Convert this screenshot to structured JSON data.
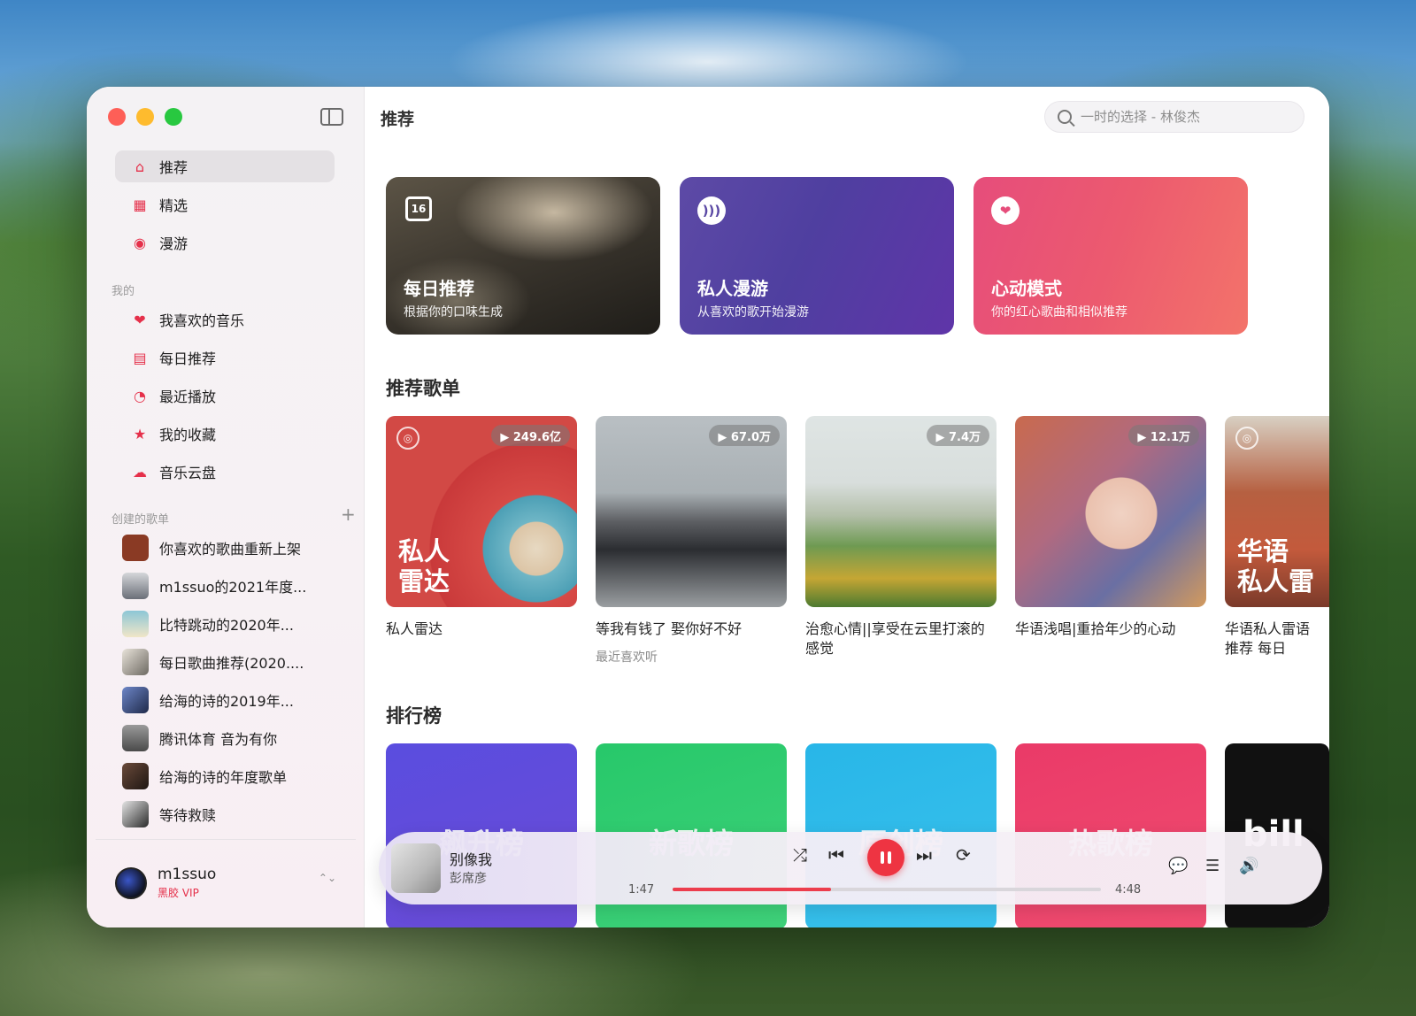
{
  "window_controls": [
    "close",
    "minimize",
    "zoom"
  ],
  "sidebar": {
    "nav": [
      {
        "label": "推荐",
        "icon": "home-icon",
        "glyph": "⌂",
        "active": true
      },
      {
        "label": "精选",
        "icon": "grid-icon",
        "glyph": "▦",
        "active": false
      },
      {
        "label": "漫游",
        "icon": "radio-icon",
        "glyph": "◉",
        "active": false
      }
    ],
    "my_label": "我的",
    "my_items": [
      {
        "label": "我喜欢的音乐",
        "icon": "heart-icon",
        "glyph": "❤"
      },
      {
        "label": "每日推荐",
        "icon": "calendar-icon",
        "glyph": "▤"
      },
      {
        "label": "最近播放",
        "icon": "clock-icon",
        "glyph": "◔"
      },
      {
        "label": "我的收藏",
        "icon": "star-icon",
        "glyph": "★"
      },
      {
        "label": "音乐云盘",
        "icon": "cloud-icon",
        "glyph": "☁"
      }
    ],
    "created_label": "创建的歌单",
    "add_glyph": "+",
    "playlists": [
      {
        "label": "你喜欢的歌曲重新上架",
        "color": "#8a3a24"
      },
      {
        "label": "m1ssuo的2021年度...",
        "color": "#6b6f78"
      },
      {
        "label": "比特跳动的2020年...",
        "color": "#8cc6d6"
      },
      {
        "label": "每日歌曲推荐(2020....",
        "color": "#b8b0a4"
      },
      {
        "label": "给海的诗的2019年...",
        "color": "#4a64a6"
      },
      {
        "label": "腾讯体育 音为有你",
        "color": "#7a7a7a"
      },
      {
        "label": "给海的诗的年度歌单",
        "color": "#3b2a22"
      },
      {
        "label": "等待救赎",
        "color": "#2a2a2a"
      }
    ],
    "user": {
      "name": "m1ssuo",
      "badge": "黑胶 VIP",
      "toggle_glyph": "⌃⌄"
    }
  },
  "header": {
    "title": "推荐",
    "search_placeholder": "一时的选择 - 林俊杰"
  },
  "feature_cards": [
    {
      "title": "每日推荐",
      "subtitle": "根据你的口味生成",
      "icon": "calendar-icon",
      "glyph": "16"
    },
    {
      "title": "私人漫游",
      "subtitle": "从喜欢的歌开始漫游",
      "icon": "radio-icon",
      "glyph": ")))"
    },
    {
      "title": "心动模式",
      "subtitle": "你的红心歌曲和相似推荐",
      "icon": "heart-icon",
      "glyph": "❤"
    }
  ],
  "sections": {
    "playlists_title": "推荐歌单",
    "charts_title": "排行榜"
  },
  "recommended_playlists": [
    {
      "name": "私人雷达",
      "plays": "▶ 249.6亿",
      "cover_text": "私人\n雷达",
      "subtitle": ""
    },
    {
      "name": "等我有钱了 娶你好不好",
      "plays": "▶ 67.0万",
      "cover_text": "",
      "subtitle": "最近喜欢听"
    },
    {
      "name": "治愈心情||享受在云里打滚的感觉",
      "plays": "▶ 7.4万",
      "cover_text": "",
      "subtitle": ""
    },
    {
      "name": "华语浅唱|重拾年少的心动",
      "plays": "▶ 12.1万",
      "cover_text": "",
      "subtitle": ""
    },
    {
      "name": "华语私人雷语推荐 每日",
      "plays": "",
      "cover_text": "华语\n私人雷",
      "subtitle": ""
    }
  ],
  "charts": [
    {
      "label": "飙升榜",
      "color": "#5a4ddf"
    },
    {
      "label": "新歌榜",
      "color": "#27c86a"
    },
    {
      "label": "原创榜",
      "color": "#28b6e8"
    },
    {
      "label": "热歌榜",
      "color": "#ea3a68"
    },
    {
      "label": "bill",
      "color": "#111111"
    }
  ],
  "player": {
    "title": "别像我",
    "artist": "彭席彦",
    "elapsed": "1:47",
    "duration": "4:48",
    "progress": 0.37,
    "controls": {
      "shuffle": "⤮",
      "prev": "⏮",
      "next": "⏭",
      "repeat": "⟳",
      "lyrics": "💬",
      "queue": "☰",
      "volume": "🔊"
    }
  }
}
